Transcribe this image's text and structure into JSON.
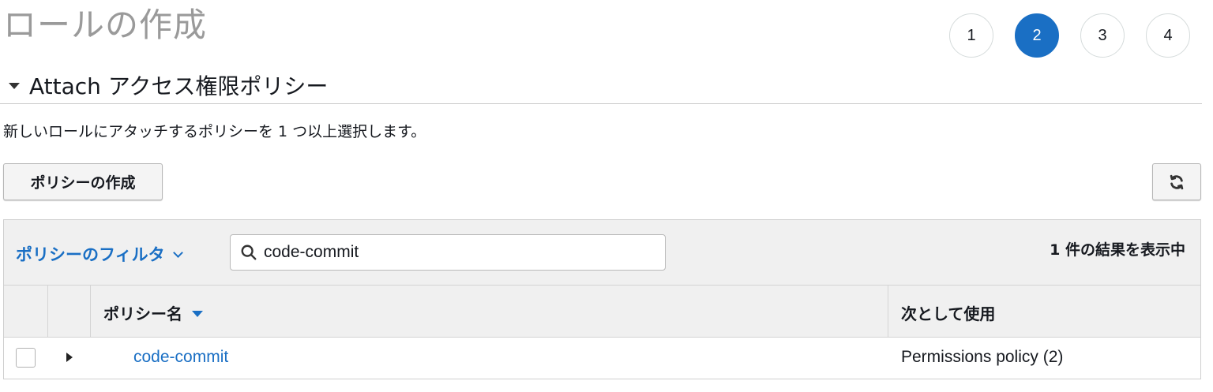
{
  "page": {
    "title": "ロールの作成"
  },
  "steps": [
    "1",
    "2",
    "3",
    "4"
  ],
  "active_step": "2",
  "section": {
    "title": "Attach アクセス権限ポリシー",
    "description": "新しいロールにアタッチするポリシーを 1 つ以上選択します。"
  },
  "toolbar": {
    "create_policy_label": "ポリシーの作成",
    "refresh_icon": "refresh-icon"
  },
  "filter": {
    "label": "ポリシーのフィルタ",
    "search_value": "code-commit",
    "result_count": "1 件の結果を表示中"
  },
  "table": {
    "columns": {
      "name": "ポリシー名",
      "used_as": "次として使用"
    },
    "rows": [
      {
        "name": "code-commit",
        "used_as": "Permissions policy (2)"
      }
    ]
  },
  "colors": {
    "accent": "#1a6fc4",
    "title_gray": "#9a9a9a",
    "toolbar_bg": "#f0f0f0"
  }
}
